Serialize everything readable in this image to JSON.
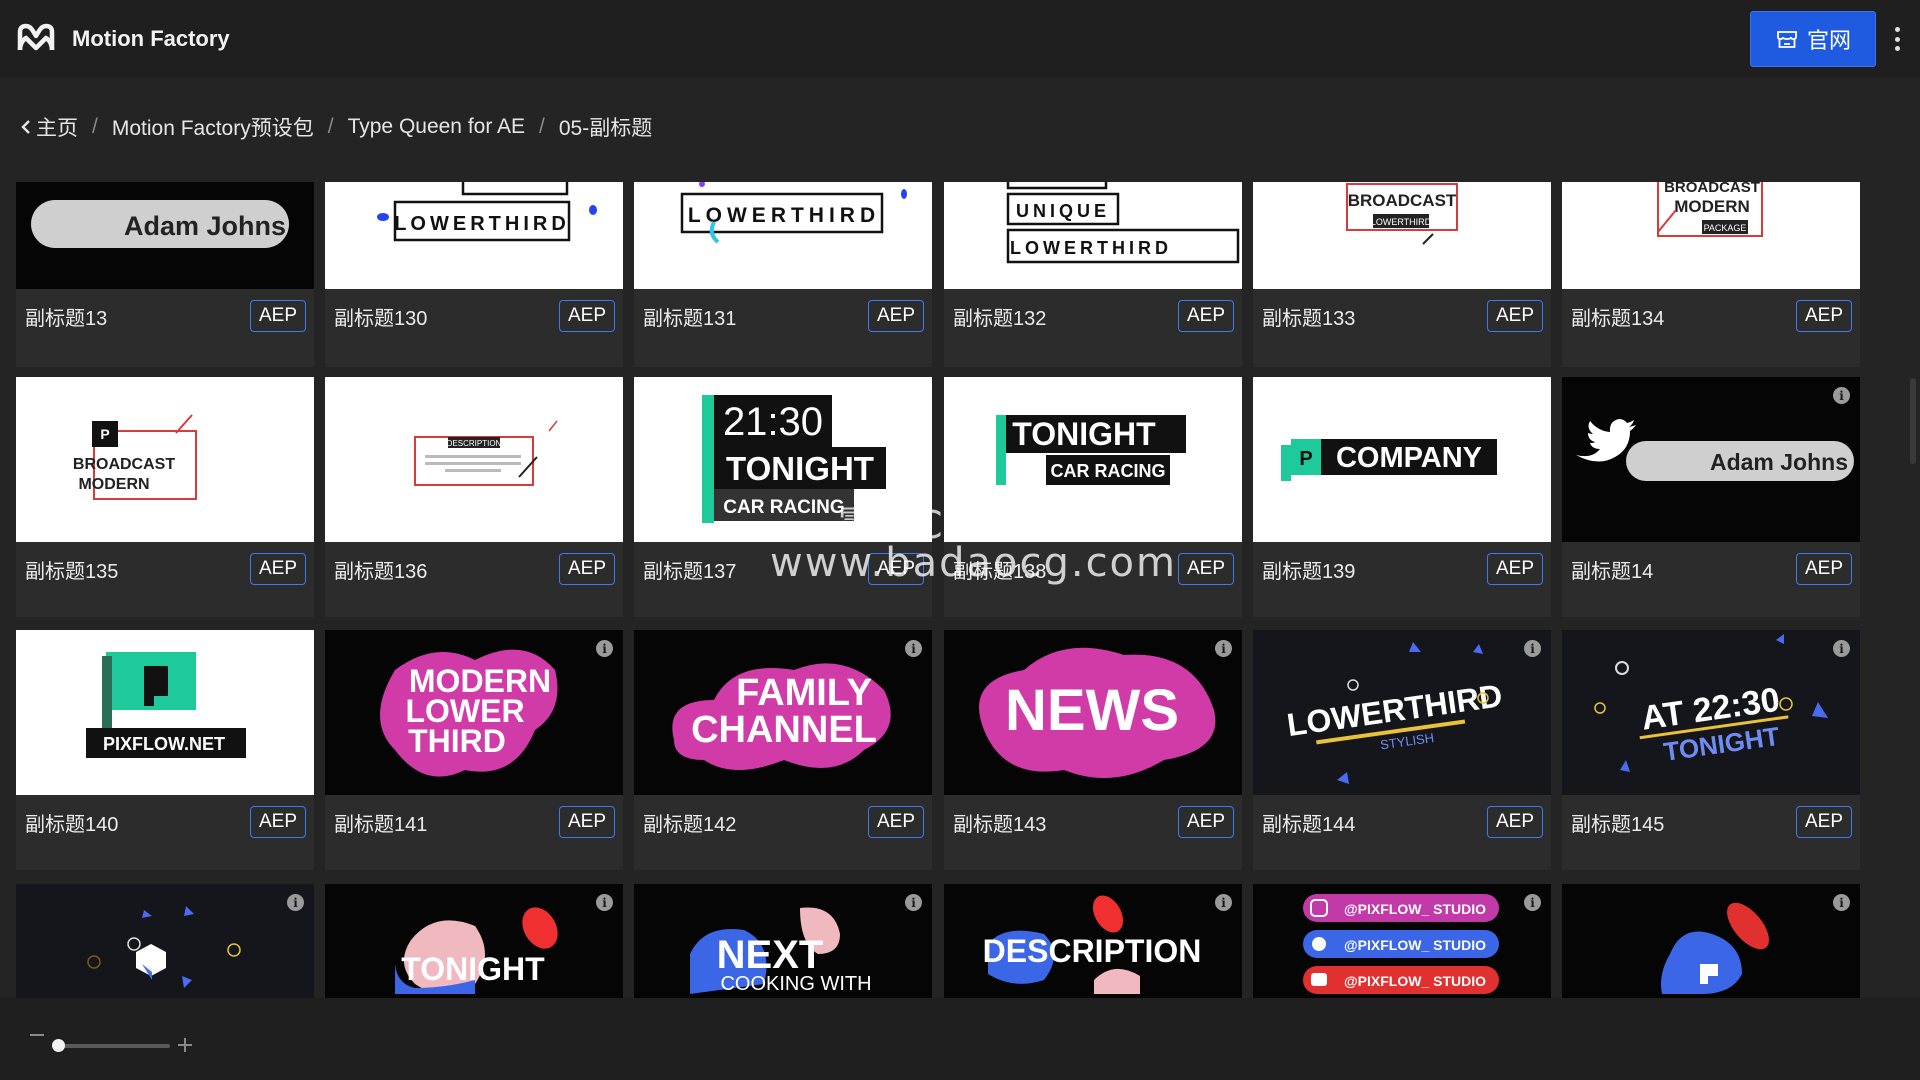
{
  "header": {
    "app_title": "Motion Factory",
    "site_button_label": "官网"
  },
  "breadcrumb": {
    "items": [
      "主页",
      "Motion Factory预设包",
      "Type Queen for AE",
      "05-副标题"
    ],
    "separator": "/"
  },
  "badge_label": "AEP",
  "cards": [
    {
      "name": "副标题13",
      "badge": "AEP"
    },
    {
      "name": "副标题130",
      "badge": "AEP"
    },
    {
      "name": "副标题131",
      "badge": "AEP"
    },
    {
      "name": "副标题132",
      "badge": "AEP"
    },
    {
      "name": "副标题133",
      "badge": "AEP"
    },
    {
      "name": "副标题134",
      "badge": "AEP"
    },
    {
      "name": "副标题135",
      "badge": "AEP"
    },
    {
      "name": "副标题136",
      "badge": "AEP"
    },
    {
      "name": "副标题137",
      "badge": "AEP"
    },
    {
      "name": "副标题138",
      "badge": "AEP"
    },
    {
      "name": "副标题139",
      "badge": "AEP"
    },
    {
      "name": "副标题14",
      "badge": "AEP"
    },
    {
      "name": "副标题140",
      "badge": "AEP"
    },
    {
      "name": "副标题141",
      "badge": "AEP"
    },
    {
      "name": "副标题142",
      "badge": "AEP"
    },
    {
      "name": "副标题143",
      "badge": "AEP"
    },
    {
      "name": "副标题144",
      "badge": "AEP"
    },
    {
      "name": "副标题145",
      "badge": "AEP"
    }
  ],
  "thumb_text": {
    "adam": "Adam Johns",
    "unique": "UNIQUE",
    "lowerthird": "LOWERTHIRD",
    "broadcast": "BROADCAST",
    "modern": "MODERN",
    "package": "PACKAGE",
    "lowerthird_small": "LOWERTHIRD",
    "description": "DESCRIPTION",
    "time": "21:30",
    "tonight": "TONIGHT",
    "car_racing": "CAR RACING",
    "company": "COMPANY",
    "pixflow": "PIXFLOW.NET",
    "modern_lower_third": [
      "MODERN",
      "LOWER",
      "THIRD"
    ],
    "family_channel": [
      "FAMILY",
      "CHANNEL"
    ],
    "news": "NEWS",
    "lowerthird_stylish": "LOWERTHIRD",
    "stylish": "STYLISH",
    "at_time": "AT 22:30",
    "tonight_b": "TONIGHT",
    "tonight_c": "TONIGHT",
    "next": "NEXT",
    "cooking_with": "COOKING WITH",
    "description_b": "DESCRIPTION",
    "social": [
      "@PIXFLOW_ STUDIO",
      "@PIXFLOW_ STUDIO",
      "@PIXFLOW_ STUDIO"
    ]
  },
  "watermark": {
    "line1": "霸道CG资源网",
    "line2": "www.badaocg.com"
  },
  "colors": {
    "accent": "#1f5be0",
    "badge_border": "#3d78f5",
    "teal": "#2bd8a8",
    "magenta": "#d13ba8",
    "card_bg": "#2c2c2c"
  }
}
